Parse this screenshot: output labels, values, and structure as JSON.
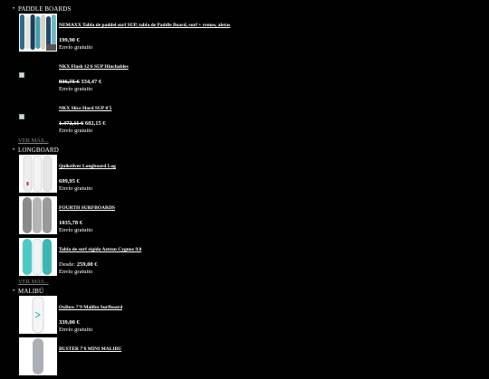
{
  "categories": [
    {
      "title": "PADDLE BOARDS",
      "products": [
        {
          "name": "NEMAXX Tabla de paddel surf SUP, tabla de Paddle Board, surf + remos, aletas",
          "old_price": "",
          "price": "199,90 €",
          "price_label": "",
          "shipping": "Envío gratuito",
          "thumb": "sup-boards"
        },
        {
          "name": "NKX Flash 12'6 SUP Hinchables",
          "old_price": "936,75 €",
          "price": "334,47 €",
          "price_label": "",
          "shipping": "Envío gratuito",
          "thumb": "broken"
        },
        {
          "name": "NKX Slice Hard SUP 8'5",
          "old_price": "1.472,11 €",
          "price": "602,15 €",
          "price_label": "",
          "shipping": "Envío gratuito",
          "thumb": "broken"
        }
      ],
      "more_label": "VER MÁS..."
    },
    {
      "title": "LONGBOARD",
      "products": [
        {
          "name": "Quiksilver Longboard Log",
          "old_price": "",
          "price": "699,95 €",
          "price_label": "",
          "shipping": "Envío gratuito",
          "thumb": "white-boards"
        },
        {
          "name": "FOURTH SURFBOARDS",
          "old_price": "",
          "price": "1035,78 €",
          "price_label": "",
          "shipping": "Envío gratuito",
          "thumb": "grey-boards"
        },
        {
          "name": "Tabla de surf rígida Aztron Cygnus 9.0",
          "old_price": "",
          "price": "259,00 €",
          "price_label": "Desde:",
          "shipping": "Envío gratuito",
          "thumb": "teal-boards"
        }
      ],
      "more_label": "VER MÁS..."
    },
    {
      "title": "MALIBÚ",
      "products": [
        {
          "name": "OxBow 7'9 Malibu Surfboard",
          "old_price": "",
          "price": "339,00 €",
          "price_label": "",
          "shipping": "Envío gratuito",
          "thumb": "white-single"
        },
        {
          "name": "BUSTER 7'6 MINI MALIBU",
          "old_price": "",
          "price": "",
          "price_label": "",
          "shipping": "",
          "thumb": "grey-single"
        }
      ],
      "more_label": ""
    }
  ]
}
